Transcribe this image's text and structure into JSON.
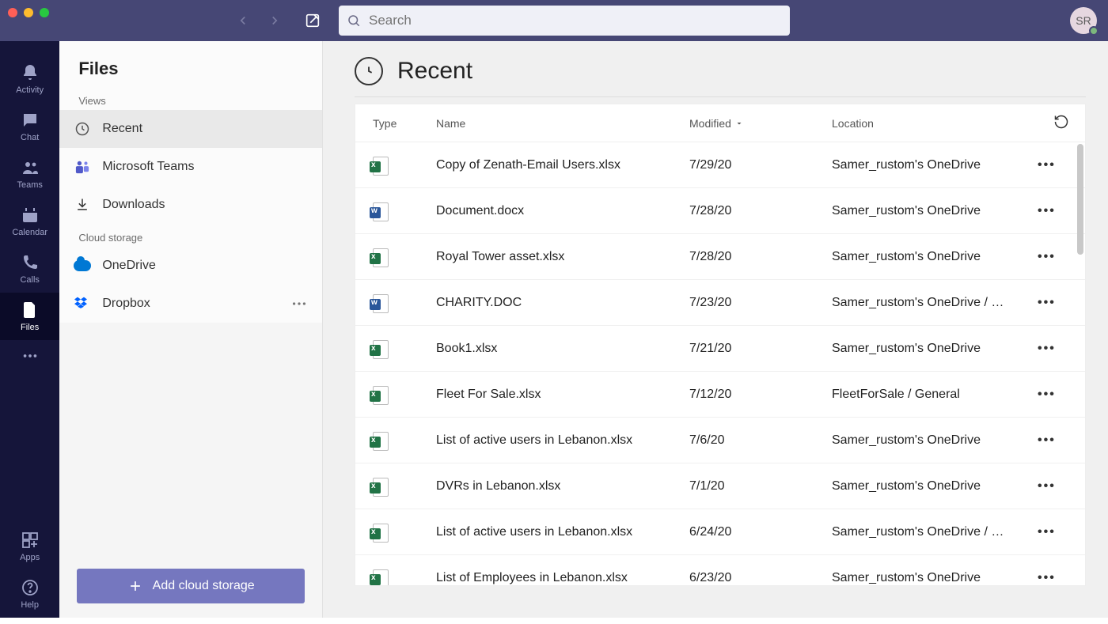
{
  "topbar": {
    "search_placeholder": "Search",
    "avatar_initials": "SR"
  },
  "rail": {
    "items": [
      {
        "label": "Activity",
        "icon": "bell"
      },
      {
        "label": "Chat",
        "icon": "chat"
      },
      {
        "label": "Teams",
        "icon": "teams"
      },
      {
        "label": "Calendar",
        "icon": "calendar"
      },
      {
        "label": "Calls",
        "icon": "calls"
      },
      {
        "label": "Files",
        "icon": "files",
        "active": true
      }
    ],
    "apps_label": "Apps",
    "help_label": "Help"
  },
  "side": {
    "title": "Files",
    "views_label": "Views",
    "views": [
      {
        "label": "Recent",
        "icon": "clock",
        "active": true
      },
      {
        "label": "Microsoft Teams",
        "icon": "teams"
      },
      {
        "label": "Downloads",
        "icon": "download"
      }
    ],
    "cloud_label": "Cloud storage",
    "cloud": [
      {
        "label": "OneDrive",
        "icon": "onedrive"
      },
      {
        "label": "Dropbox",
        "icon": "dropbox",
        "has_more": true
      }
    ],
    "add_button": "Add cloud storage"
  },
  "content": {
    "title": "Recent",
    "columns": {
      "type": "Type",
      "name": "Name",
      "modified": "Modified",
      "location": "Location"
    },
    "rows": [
      {
        "type": "excel",
        "name": "Copy of Zenath-Email Users.xlsx",
        "modified": "7/29/20",
        "location": "Samer_rustom's OneDrive"
      },
      {
        "type": "word",
        "name": "Document.docx",
        "modified": "7/28/20",
        "location": "Samer_rustom's OneDrive"
      },
      {
        "type": "excel",
        "name": "Royal Tower asset.xlsx",
        "modified": "7/28/20",
        "location": "Samer_rustom's OneDrive"
      },
      {
        "type": "word",
        "name": "CHARITY.DOC",
        "modified": "7/23/20",
        "location": "Samer_rustom's OneDrive / …"
      },
      {
        "type": "excel",
        "name": "Book1.xlsx",
        "modified": "7/21/20",
        "location": "Samer_rustom's OneDrive"
      },
      {
        "type": "excel",
        "name": "Fleet For Sale.xlsx",
        "modified": "7/12/20",
        "location": "FleetForSale / General"
      },
      {
        "type": "excel",
        "name": "List of active users in Lebanon.xlsx",
        "modified": "7/6/20",
        "location": "Samer_rustom's OneDrive"
      },
      {
        "type": "excel",
        "name": "DVRs in Lebanon.xlsx",
        "modified": "7/1/20",
        "location": "Samer_rustom's OneDrive"
      },
      {
        "type": "excel",
        "name": "List of active users in Lebanon.xlsx",
        "modified": "6/24/20",
        "location": "Samer_rustom's OneDrive / …"
      },
      {
        "type": "excel",
        "name": "List of Employees in Lebanon.xlsx",
        "modified": "6/23/20",
        "location": "Samer_rustom's OneDrive"
      }
    ]
  }
}
